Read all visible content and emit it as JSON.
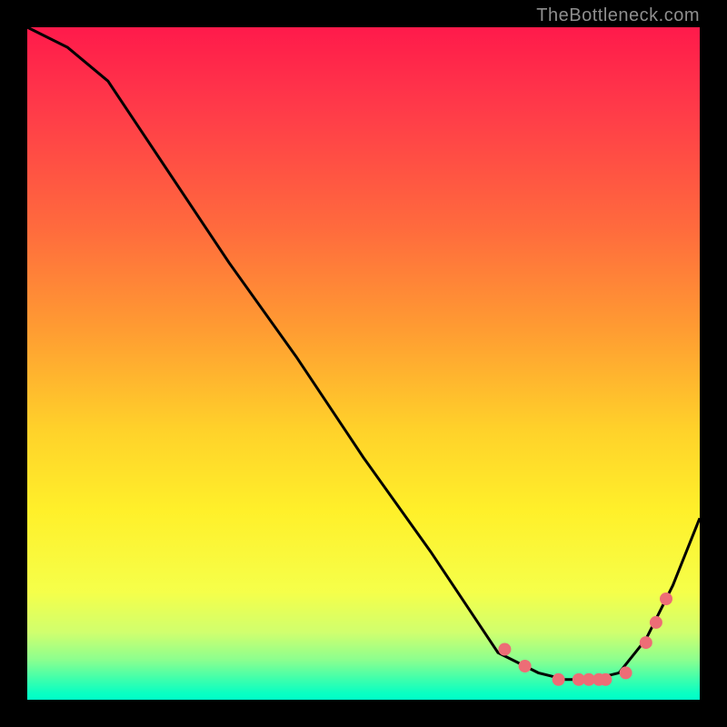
{
  "attribution": "TheBottleneck.com",
  "chart_data": {
    "type": "line",
    "title": "",
    "xlabel": "",
    "ylabel": "",
    "xlim": [
      0,
      100
    ],
    "ylim": [
      0,
      100
    ],
    "grid": false,
    "legend": false,
    "series": [
      {
        "name": "curve",
        "x": [
          0,
          6,
          12,
          20,
          30,
          40,
          50,
          60,
          70,
          76,
          80,
          84,
          88,
          92,
          96,
          100
        ],
        "y": [
          100,
          97,
          92,
          80,
          65,
          51,
          36,
          22,
          7,
          4,
          3,
          3,
          4,
          9,
          17,
          27
        ]
      },
      {
        "name": "dots",
        "type": "scatter",
        "x": [
          71,
          74,
          79,
          82,
          83.5,
          85,
          86,
          89,
          92,
          93.5,
          95
        ],
        "y": [
          7.5,
          5.0,
          3.0,
          3.0,
          3.0,
          3.0,
          3.0,
          4.0,
          8.5,
          11.5,
          15.0
        ]
      }
    ],
    "colors": {
      "curve": "#000000",
      "dots": "#ed6d76"
    }
  }
}
